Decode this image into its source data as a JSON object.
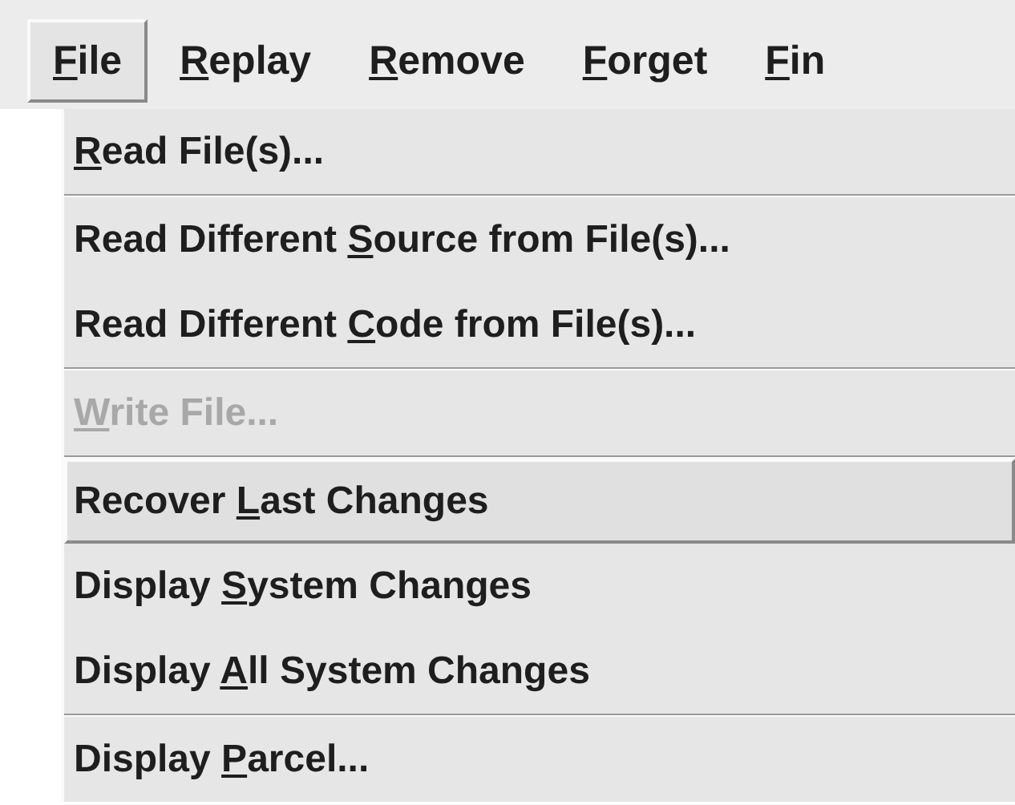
{
  "menu_bar": [
    {
      "key": "F",
      "post": "ile",
      "selected": true
    },
    {
      "key": "R",
      "post": "eplay",
      "selected": false
    },
    {
      "key": "R",
      "post": "emove",
      "selected": false
    },
    {
      "key": "F",
      "post": "orget",
      "selected": false
    },
    {
      "key": "F",
      "post": "in",
      "selected": false
    }
  ],
  "menu": {
    "groups": [
      [
        {
          "key": "R",
          "post": "ead File(s)...",
          "disabled": false,
          "selected": false
        }
      ],
      [
        {
          "pre": "Read Different ",
          "key": "S",
          "post": "ource from File(s)...",
          "disabled": false,
          "selected": false
        },
        {
          "pre": "Read Different ",
          "key": "C",
          "post": "ode from File(s)...",
          "disabled": false,
          "selected": false
        }
      ],
      [
        {
          "key": "W",
          "post": "rite File...",
          "disabled": true,
          "selected": false
        }
      ],
      [
        {
          "pre": "Recover ",
          "key": "L",
          "post": "ast Changes",
          "disabled": false,
          "selected": true
        },
        {
          "pre": "Display ",
          "key": "S",
          "post": "ystem Changes",
          "disabled": false,
          "selected": false
        },
        {
          "pre": "Display ",
          "key": "A",
          "post": "ll System Changes",
          "disabled": false,
          "selected": false
        }
      ],
      [
        {
          "pre": "Display ",
          "key": "P",
          "post": "arcel...",
          "disabled": false,
          "selected": false
        }
      ]
    ]
  }
}
